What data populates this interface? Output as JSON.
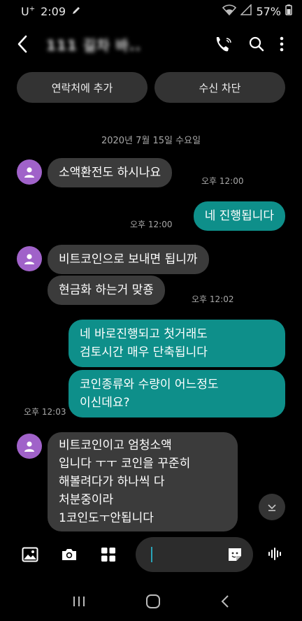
{
  "status": {
    "carrier": "U",
    "carrier_sup": "+",
    "time": "2:09",
    "battery": "57%"
  },
  "header": {
    "contact": "111 길차 바.."
  },
  "actions": {
    "add_contact": "연락처에 추가",
    "block": "수신 차단"
  },
  "date": "2020년 7월 15일 수요일",
  "messages": [
    {
      "dir": "in",
      "lines": [
        "소액환전도 하시나요"
      ],
      "time": "오후 12:00"
    },
    {
      "dir": "out",
      "lines": [
        "네 진행됩니다"
      ],
      "time": "오후 12:00"
    },
    {
      "dir": "in",
      "lines": [
        "비트코인으로 보내면 됩니까"
      ]
    },
    {
      "dir": "in",
      "lines": [
        "현금화 하는거 맞죵"
      ],
      "time": "오후 12:02"
    },
    {
      "dir": "out",
      "lines": [
        "네 바로진행되고 첫거래도",
        "검토시간 매우 단축됩니다"
      ]
    },
    {
      "dir": "out",
      "lines": [
        "코인종류와 수량이 어느정도",
        "이신데요?"
      ],
      "time": "오후 12:03"
    },
    {
      "dir": "in",
      "lines": [
        "비트코인이고 엄청소액",
        "입니다 ㅜㅜ 코인을 꾸준히",
        "해볼려다가 하나씩 다",
        "처분중이라",
        "1코인도ㅜ안됩니다"
      ]
    }
  ],
  "colors": {
    "incoming": "#3b3b3b",
    "outgoing": "#0e8f8a",
    "avatar": "#a062c9",
    "background": "#000000"
  }
}
